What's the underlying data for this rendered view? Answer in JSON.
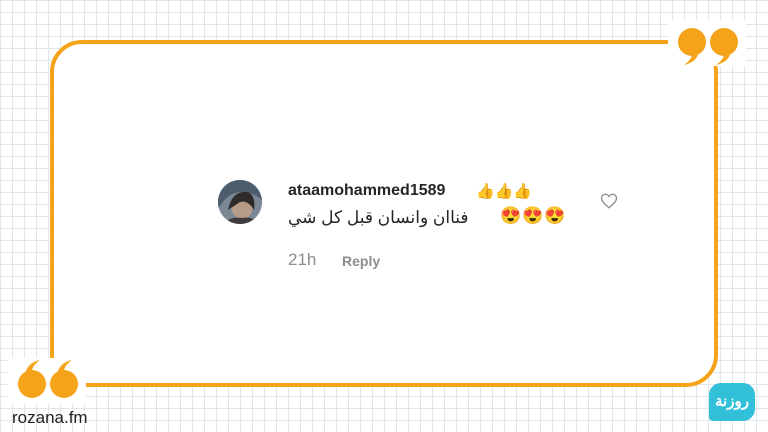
{
  "comment": {
    "username": "ataamohammed1589",
    "username_emoji": "👍👍👍",
    "text": "فناان وانسان قبل كل شي",
    "text_emoji": "😍😍😍",
    "time": "21h",
    "reply_label": "Reply"
  },
  "icons": {
    "avatar": "avatar",
    "like": "heart-icon",
    "quote": "quote-mark-icon",
    "logo": "rozana-logo"
  },
  "brand": {
    "site": "rozana.fm",
    "logo_text": "روزنة"
  },
  "colors": {
    "accent": "#f5a31a",
    "logo": "#31c0d8",
    "muted": "#8e8e8e"
  }
}
